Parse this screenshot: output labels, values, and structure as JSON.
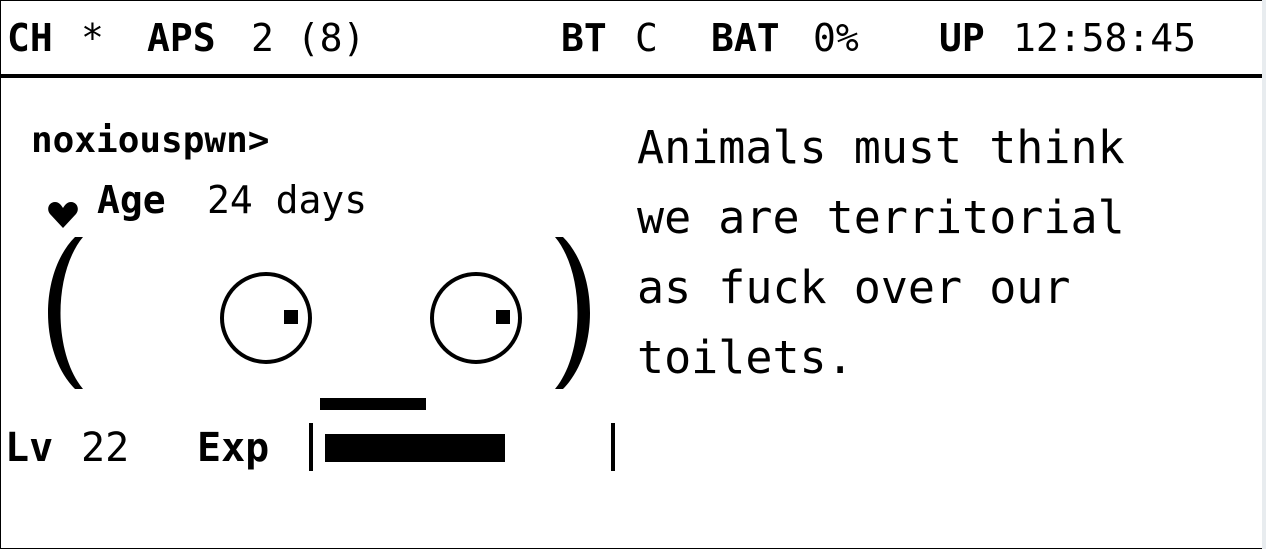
{
  "status_bar": {
    "ch_label": "CH",
    "ch_value": "*",
    "aps_label": "APS",
    "aps_value": "2 (8)",
    "bt_label": "BT",
    "bt_value": "C",
    "bat_label": "BAT",
    "bat_value": "0%",
    "up_label": "UP",
    "up_value": "12:58:45"
  },
  "pet": {
    "name": "noxiouspwn>",
    "age_label": "Age",
    "age_value": "24 days",
    "heart_icon": "heart-icon",
    "face_icon": "pwnagotchi-face-icon"
  },
  "message": {
    "lines": [
      "Animals must think",
      "we are territorial",
      "as fuck over our",
      "toilets."
    ]
  },
  "level": {
    "lv_label": "Lv",
    "lv_value": "22",
    "exp_label": "Exp",
    "exp_fraction": 0.6
  }
}
